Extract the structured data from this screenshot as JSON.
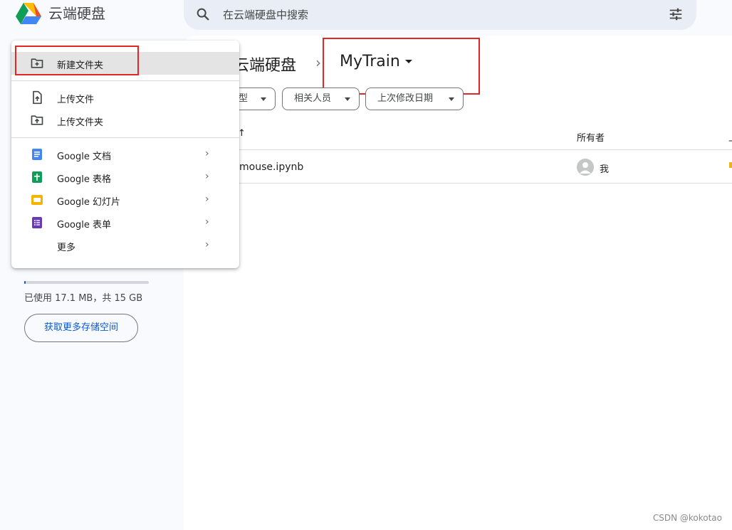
{
  "app": {
    "title": "云端硬盘",
    "logo_icon": "google-drive-logo"
  },
  "search": {
    "placeholder": "在云端硬盘中搜索",
    "icon": "search-icon",
    "filter_icon": "tune-icon"
  },
  "breadcrumb": {
    "root": "云端硬盘",
    "separator": "›",
    "current": "MyTrain"
  },
  "filters": [
    {
      "label": "型"
    },
    {
      "label": "相关人员"
    },
    {
      "label": "上次修改日期"
    }
  ],
  "table": {
    "headers": {
      "name_arrow": "↑",
      "owner": "所有者",
      "edge": "上"
    },
    "rows": [
      {
        "name": "mouse.ipynb",
        "owner": "我"
      }
    ]
  },
  "menu": {
    "items": [
      {
        "label": "新建文件夹",
        "icon": "new-folder-icon",
        "highlighted": true
      },
      {
        "label": "上传文件",
        "icon": "upload-file-icon"
      },
      {
        "label": "上传文件夹",
        "icon": "upload-folder-icon"
      },
      {
        "label": "Google 文档",
        "icon": "google-docs-icon",
        "color": "#4285f4",
        "submenu": true
      },
      {
        "label": "Google 表格",
        "icon": "google-sheets-icon",
        "color": "#0f9d58",
        "submenu": true
      },
      {
        "label": "Google 幻灯片",
        "icon": "google-slides-icon",
        "color": "#f4b400",
        "submenu": true
      },
      {
        "label": "Google 表单",
        "icon": "google-forms-icon",
        "color": "#673ab7",
        "submenu": true
      },
      {
        "label": "更多",
        "icon": "",
        "submenu": true
      }
    ],
    "submenu_arrow": "›"
  },
  "storage": {
    "used_text": "已使用 17.1 MB，共 15 GB",
    "used_fraction": 0.001,
    "button_label": "获取更多存储空间"
  },
  "annotation_color": "#e32626",
  "watermark": "CSDN @kokotao"
}
